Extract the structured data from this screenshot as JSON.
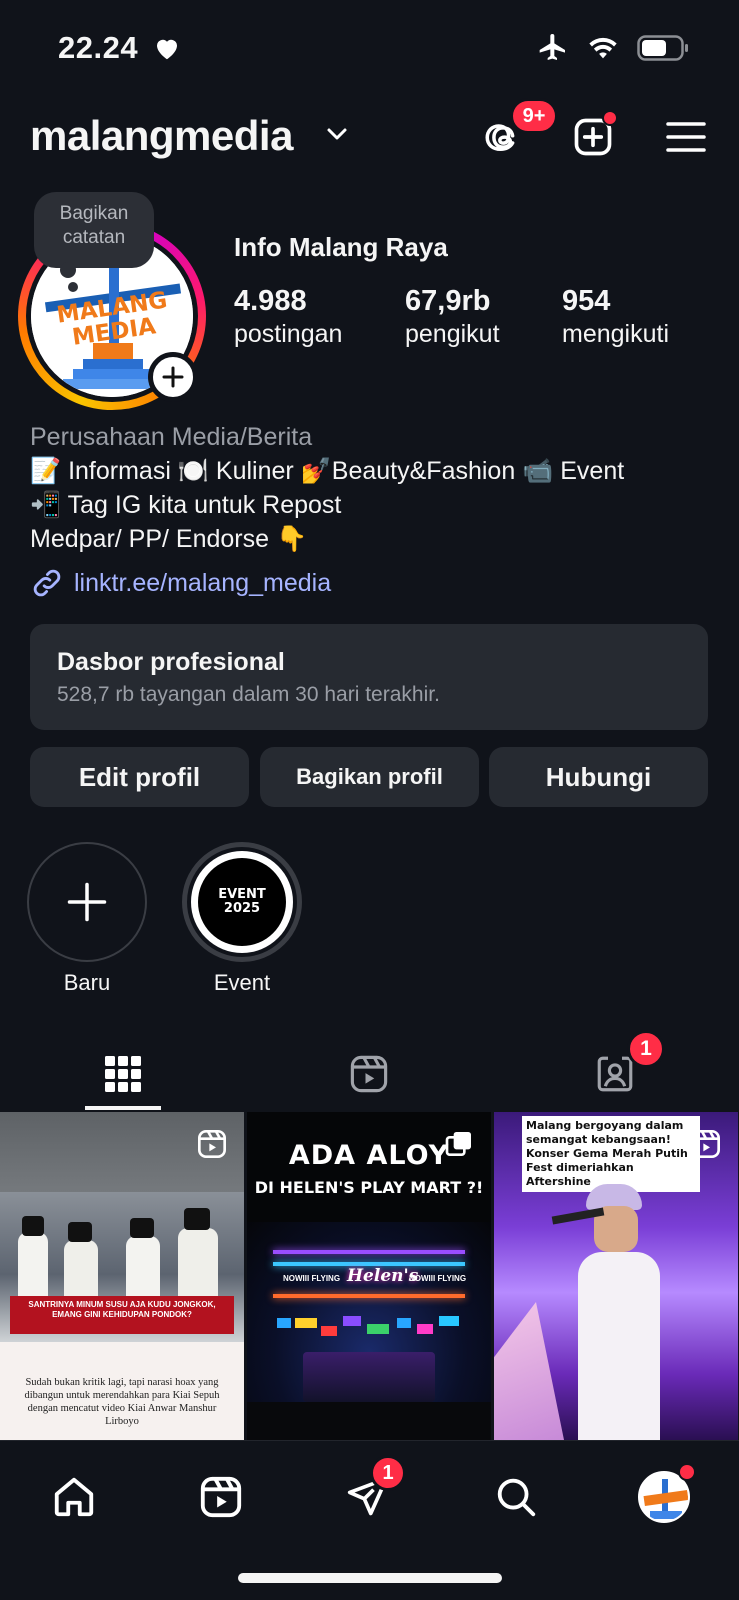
{
  "status_bar": {
    "time": "22.24"
  },
  "header": {
    "username": "malangmedia",
    "threads_badge": "9+"
  },
  "profile": {
    "note": "Bagikan catatan",
    "display_name": "Info Malang Raya",
    "avatar_text_line1": "MALANG",
    "avatar_text_line2": "MEDIA",
    "stats": [
      {
        "value": "4.988",
        "label": "postingan"
      },
      {
        "value": "67,9rb",
        "label": "pengikut"
      },
      {
        "value": "954",
        "label": "mengikuti"
      }
    ],
    "category": "Perusahaan Media/Berita",
    "bio_lines": [
      "📝 Informasi 🍽️ Kuliner 💅Beauty&Fashion 📹 Event",
      "📲 Tag IG kita untuk Repost",
      "Medpar/ PP/ Endorse 👇"
    ],
    "link": "linktr.ee/malang_media"
  },
  "dashboard": {
    "title": "Dasbor profesional",
    "subtitle": "528,7 rb tayangan dalam 30 hari terakhir."
  },
  "buttons": {
    "edit": "Edit profil",
    "share": "Bagikan profil",
    "contact": "Hubungi"
  },
  "highlights": [
    {
      "label": "Baru"
    },
    {
      "label": "Event",
      "cover_line1": "EVENT",
      "cover_line2": "2025"
    }
  ],
  "tabs": {
    "tagged_badge": "1"
  },
  "posts": [
    {
      "caption1": "SANTRINYA MINUM SUSU AJA KUDU JONGKOK, EMANG GINI KEHIDUPAN PONDOK?",
      "caption2": "Sudah bukan kritik lagi, tapi narasi hoax yang dibangun untuk merendahkan para Kiai Sepuh dengan mencatut video Kiai Anwar Manshur Lirboyo"
    },
    {
      "title1": "ADA ALOY",
      "title2": "DI HELEN'S PLAY MART ?!",
      "sign": "Helen's",
      "sign_left": "NOWIII FLYING",
      "sign_right": "NOWIII FLYING"
    },
    {
      "caption_lines": [
        "Malang bergoyang dalam",
        "semangat kebangsaan!",
        "Konser Gema Merah Putih",
        "Fest dimeriahkan Aftershine"
      ]
    }
  ],
  "bottom_nav": {
    "messages_badge": "1"
  },
  "colors": {
    "background": "#10131a",
    "card": "#262a31",
    "link": "#a6b4ff",
    "badge": "#ff2d46"
  }
}
